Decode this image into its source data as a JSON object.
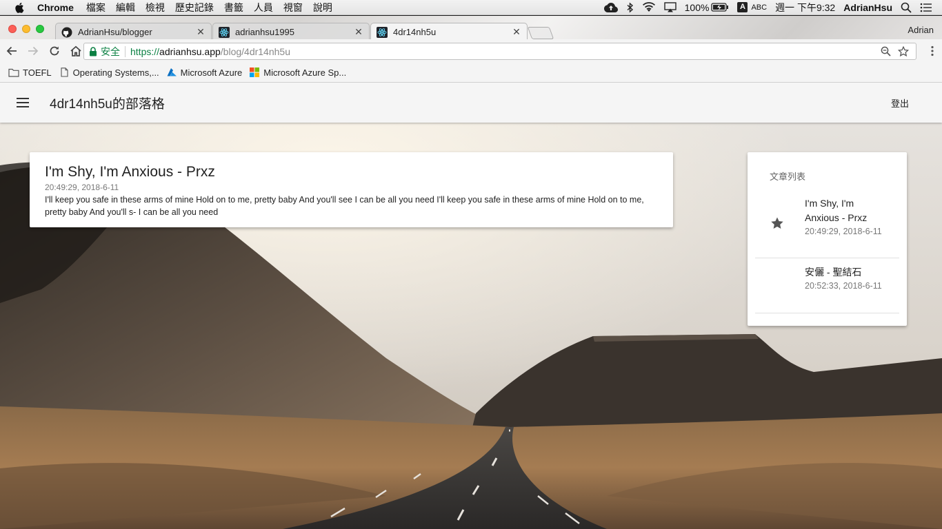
{
  "menubar": {
    "app_name": "Chrome",
    "menus": [
      "檔案",
      "編輯",
      "檢視",
      "歷史記錄",
      "書籤",
      "人員",
      "視窗",
      "說明"
    ],
    "battery": "100%",
    "input_source_letter": "A",
    "input_source": "ABC",
    "clock": "週一 下午9:32",
    "user": "AdrianHsu"
  },
  "browser": {
    "profile": "Adrian",
    "tabs": [
      {
        "title": "AdrianHsu/blogger",
        "icon": "github-icon"
      },
      {
        "title": "adrianhsu1995",
        "icon": "react-icon"
      },
      {
        "title": "4dr14nh5u",
        "icon": "react-icon"
      }
    ],
    "omnibox": {
      "secure_label": "安全",
      "scheme": "https://",
      "host": "adrianhsu.app",
      "path": "/blog/4dr14nh5u"
    },
    "bookmarks": [
      {
        "label": "TOEFL",
        "icon": "folder-icon"
      },
      {
        "label": "Operating Systems,...",
        "icon": "page-icon"
      },
      {
        "label": "Microsoft Azure",
        "icon": "azure-icon"
      },
      {
        "label": "Microsoft Azure Sp...",
        "icon": "microsoft-icon"
      }
    ]
  },
  "app": {
    "brand": "4dr14nh5u的部落格",
    "logout": "登出"
  },
  "post": {
    "title": "I'm Shy, I'm Anxious - Prxz",
    "date": "20:49:29, 2018-6-11",
    "body": "I'll keep you safe in these arms of mine Hold on to me, pretty baby And you'll see I can be all you need I'll keep you safe in these arms of mine Hold on to me, pretty baby And you'll s- I can be all you need"
  },
  "article_list": {
    "heading": "文章列表",
    "items": [
      {
        "title": "I'm Shy, I'm Anxious - Prxz",
        "date": "20:49:29, 2018-6-11",
        "starred": true
      },
      {
        "title": "安儷 - 聖結石",
        "date": "20:52:33, 2018-6-11",
        "starred": false
      }
    ]
  },
  "colors": {
    "secure_green": "#0b8043",
    "appbar_bg": "#f5f5f5",
    "card_bg": "#ffffff"
  }
}
